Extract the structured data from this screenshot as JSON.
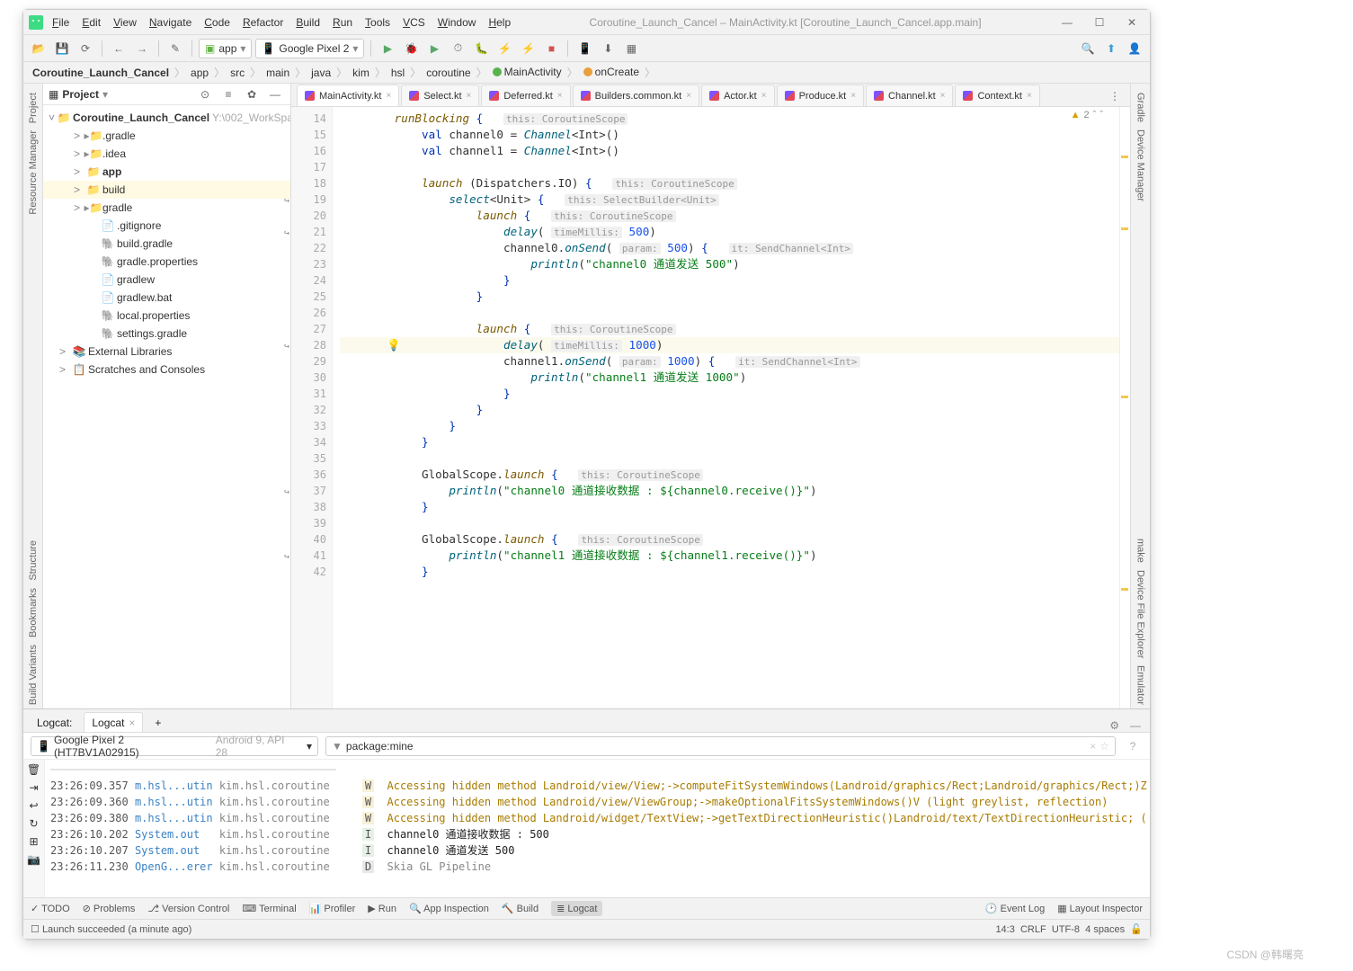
{
  "window": {
    "title": "Coroutine_Launch_Cancel – MainActivity.kt [Coroutine_Launch_Cancel.app.main]"
  },
  "menu": [
    "File",
    "Edit",
    "View",
    "Navigate",
    "Code",
    "Refactor",
    "Build",
    "Run",
    "Tools",
    "VCS",
    "Window",
    "Help"
  ],
  "toolbar": {
    "run_config": "app",
    "device": "Google Pixel 2"
  },
  "breadcrumb": [
    "Coroutine_Launch_Cancel",
    "app",
    "src",
    "main",
    "java",
    "kim",
    "hsl",
    "coroutine"
  ],
  "breadcrumb_tail": [
    {
      "icon": "#58b24d",
      "label": "MainActivity"
    },
    {
      "icon": "#e89f3c",
      "label": "onCreate"
    }
  ],
  "project": {
    "title": "Project",
    "root": {
      "label": "Coroutine_Launch_Cancel",
      "hint": "Y:\\002_WorkSpac"
    },
    "items": [
      {
        "depth": 1,
        "arrow": ">",
        "icon": "folder",
        "label": ".gradle"
      },
      {
        "depth": 1,
        "arrow": ">",
        "icon": "folder",
        "label": ".idea"
      },
      {
        "depth": 1,
        "arrow": ">",
        "icon": "folder green",
        "label": "app",
        "bold": true
      },
      {
        "depth": 1,
        "arrow": ">",
        "icon": "folder red",
        "label": "build",
        "sel": true
      },
      {
        "depth": 1,
        "arrow": ">",
        "icon": "folder",
        "label": "gradle"
      },
      {
        "depth": 2,
        "icon": "file",
        "label": ".gitignore"
      },
      {
        "depth": 2,
        "icon": "gradle",
        "label": "build.gradle"
      },
      {
        "depth": 2,
        "icon": "gradle",
        "label": "gradle.properties"
      },
      {
        "depth": 2,
        "icon": "file",
        "label": "gradlew"
      },
      {
        "depth": 2,
        "icon": "file",
        "label": "gradlew.bat"
      },
      {
        "depth": 2,
        "icon": "gradle",
        "label": "local.properties"
      },
      {
        "depth": 2,
        "icon": "gradle",
        "label": "settings.gradle"
      },
      {
        "depth": 0,
        "arrow": ">",
        "icon": "lib",
        "label": "External Libraries"
      },
      {
        "depth": 0,
        "arrow": ">",
        "icon": "scratch",
        "label": "Scratches and Consoles"
      }
    ]
  },
  "tabs": [
    {
      "label": "MainActivity.kt",
      "active": true
    },
    {
      "label": "Select.kt"
    },
    {
      "label": "Deferred.kt"
    },
    {
      "label": "Builders.common.kt"
    },
    {
      "label": "Actor.kt"
    },
    {
      "label": "Produce.kt"
    },
    {
      "label": "Channel.kt"
    },
    {
      "label": "Context.kt"
    }
  ],
  "code": {
    "start": 14,
    "lines": [
      {
        "html": "        <span class='fn'>runBlocking</span> <span class='kw'>{</span>   <span class='hint'>this: CoroutineScope</span>"
      },
      {
        "html": "            <span class='kw'>val</span> channel0 = <span class='fn2'>Channel</span>&lt;Int&gt;()"
      },
      {
        "html": "            <span class='kw'>val</span> channel1 = <span class='fn2'>Channel</span>&lt;Int&gt;()"
      },
      {
        "html": ""
      },
      {
        "html": "            <span class='fn'>launch</span> (Dispatchers.IO) <span class='kw'>{</span>   <span class='hint'>this: CoroutineScope</span>"
      },
      {
        "html": "                <span class='fn2'>select</span>&lt;Unit&gt; <span class='kw'>{</span>   <span class='hint'>this: SelectBuilder&lt;Unit&gt;</span>",
        "mk": "↵"
      },
      {
        "html": "                    <span class='fn'>launch</span> <span class='kw'>{</span>   <span class='hint'>this: CoroutineScope</span>"
      },
      {
        "html": "                        <span class='fn2'>delay</span>( <span class='hint'>timeMillis:</span> <span class='num'>500</span>)",
        "mk": "↵"
      },
      {
        "html": "                        channel0.<span class='fn2'>onSend</span>( <span class='hint'>param:</span> <span class='num'>500</span>) <span class='kw'>{</span>   <span class='hint'>it: SendChannel&lt;Int&gt;</span>"
      },
      {
        "html": "                            <span class='fn2'>println</span>(<span class='str'>\"channel0 通道发送 500\"</span>)"
      },
      {
        "html": "                        <span class='kw'>}</span>"
      },
      {
        "html": "                    <span class='kw'>}</span>"
      },
      {
        "html": ""
      },
      {
        "html": "                    <span class='fn'>launch</span> <span class='kw'>{</span>   <span class='hint'>this: CoroutineScope</span>"
      },
      {
        "html": "                        <span class='fn2'>delay</span>( <span class='hint'>timeMillis:</span> <span class='num'>1000</span>)",
        "mk": "↵",
        "hl": true,
        "bulb": true
      },
      {
        "html": "                        channel1.<span class='fn2'>onSend</span>( <span class='hint'>param:</span> <span class='num'>1000</span>) <span class='kw'>{</span>   <span class='hint'>it: SendChannel&lt;Int&gt;</span>"
      },
      {
        "html": "                            <span class='fn2'>println</span>(<span class='str'>\"channel1 通道发送 1000\"</span>)"
      },
      {
        "html": "                        <span class='kw'>}</span>"
      },
      {
        "html": "                    <span class='kw'>}</span>"
      },
      {
        "html": "                <span class='kw'>}</span>"
      },
      {
        "html": "            <span class='kw'>}</span>"
      },
      {
        "html": ""
      },
      {
        "html": "            GlobalScope.<span class='fn'>launch</span> <span class='kw'>{</span>   <span class='hint'>this: CoroutineScope</span>"
      },
      {
        "html": "                <span class='fn2'>println</span>(<span class='str'>\"channel0 通道接收数据 : ${channel0.receive()}\"</span>)",
        "mk": "↵"
      },
      {
        "html": "            <span class='kw'>}</span>"
      },
      {
        "html": ""
      },
      {
        "html": "            GlobalScope.<span class='fn'>launch</span> <span class='kw'>{</span>   <span class='hint'>this: CoroutineScope</span>"
      },
      {
        "html": "                <span class='fn2'>println</span>(<span class='str'>\"channel1 通道接收数据 : ${channel1.receive()}\"</span>)",
        "mk": "↵"
      },
      {
        "html": "            <span class='kw'>}</span>"
      }
    ],
    "warnings": "2"
  },
  "logcat": {
    "tabs": [
      "Logcat:",
      "Logcat"
    ],
    "device": "Google Pixel 2 (HT7BV1A02915)",
    "device_hint": "Android 9, API 28",
    "filter": "package:mine",
    "lines": [
      {
        "ts": "23:26:09.357",
        "tag": "m.hsl...utin",
        "pkg": "kim.hsl.coroutine",
        "lvl": "W",
        "msg": "Accessing hidden method Landroid/view/View;->computeFitSystemWindows(Landroid/graphics/Rect;Landroid/graphics/Rect;)Z"
      },
      {
        "ts": "23:26:09.360",
        "tag": "m.hsl...utin",
        "pkg": "kim.hsl.coroutine",
        "lvl": "W",
        "msg": "Accessing hidden method Landroid/view/ViewGroup;->makeOptionalFitsSystemWindows()V (light greylist, reflection)"
      },
      {
        "ts": "23:26:09.380",
        "tag": "m.hsl...utin",
        "pkg": "kim.hsl.coroutine",
        "lvl": "W",
        "msg": "Accessing hidden method Landroid/widget/TextView;->getTextDirectionHeuristic()Landroid/text/TextDirectionHeuristic; ("
      },
      {
        "ts": "23:26:10.202",
        "tag": "System.out",
        "pkg": "kim.hsl.coroutine",
        "lvl": "I",
        "msg": "channel0 通道接收数据 : 500"
      },
      {
        "ts": "23:26:10.207",
        "tag": "System.out",
        "pkg": "kim.hsl.coroutine",
        "lvl": "I",
        "msg": "channel0 通道发送 500"
      },
      {
        "ts": "23:26:11.230",
        "tag": "OpenG...erer",
        "pkg": "kim.hsl.coroutine",
        "lvl": "D",
        "msg": "Skia GL Pipeline"
      }
    ]
  },
  "bottom": [
    "TODO",
    "Problems",
    "Version Control",
    "Terminal",
    "Profiler",
    "Run",
    "App Inspection",
    "Build",
    "Logcat"
  ],
  "bottom_right": [
    "Event Log",
    "Layout Inspector"
  ],
  "status": {
    "msg": "Launch succeeded (a minute ago)",
    "pos": "14:3",
    "eol": "CRLF",
    "enc": "UTF-8",
    "indent": "4 spaces"
  },
  "side_left": [
    "Project",
    "Resource Manager"
  ],
  "side_left_bottom": [
    "Structure",
    "Bookmarks",
    "Build Variants"
  ],
  "side_right": [
    "Gradle",
    "Device Manager"
  ],
  "side_right_bottom": [
    "make",
    "Device File Explorer",
    "Emulator"
  ],
  "watermark": "CSDN @韩曙亮"
}
